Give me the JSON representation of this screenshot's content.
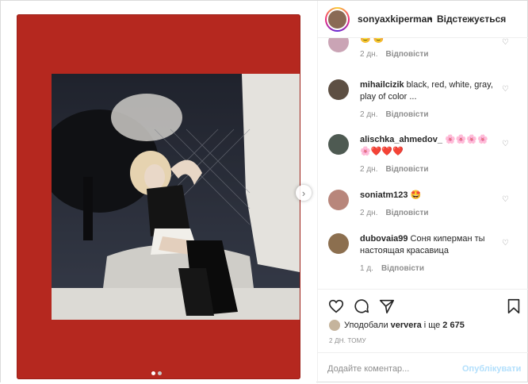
{
  "header": {
    "username": "sonyaxkiperman",
    "separator": "•",
    "follow_label": "Відстежується"
  },
  "comments": [
    {
      "user": "",
      "text": "",
      "time": "2 дн.",
      "reply_label": "Відповісти",
      "partial": true
    },
    {
      "user": "mihailcizik",
      "text": "black, red, white, gray, play of color ...",
      "time": "2 дн.",
      "reply_label": "Відповісти"
    },
    {
      "user": "alischka_ahmedov_",
      "text": "🌸🌸🌸🌸 🌸❤️❤️❤️",
      "time": "2 дн.",
      "reply_label": "Відповісти"
    },
    {
      "user": "soniatm123",
      "text": "🤩",
      "time": "2 дн.",
      "reply_label": "Відповісти"
    },
    {
      "user": "dubovaia99",
      "text": "Соня киперман ты настоящая красавица",
      "time": "1 д.",
      "reply_label": "Відповісти"
    }
  ],
  "likes": {
    "prefix": "Уподобали",
    "user": "ververa",
    "middle": "і ще",
    "count": "2 675"
  },
  "time_ago": "2 ДН. ТОМУ",
  "add_comment": {
    "placeholder": "Додайте коментар...",
    "publish_label": "Опублікувати"
  },
  "carousel": {
    "total": 2,
    "active": 1
  },
  "colors": {
    "polaroid": "#b5281f",
    "publish_disabled": "#b2dffc"
  }
}
